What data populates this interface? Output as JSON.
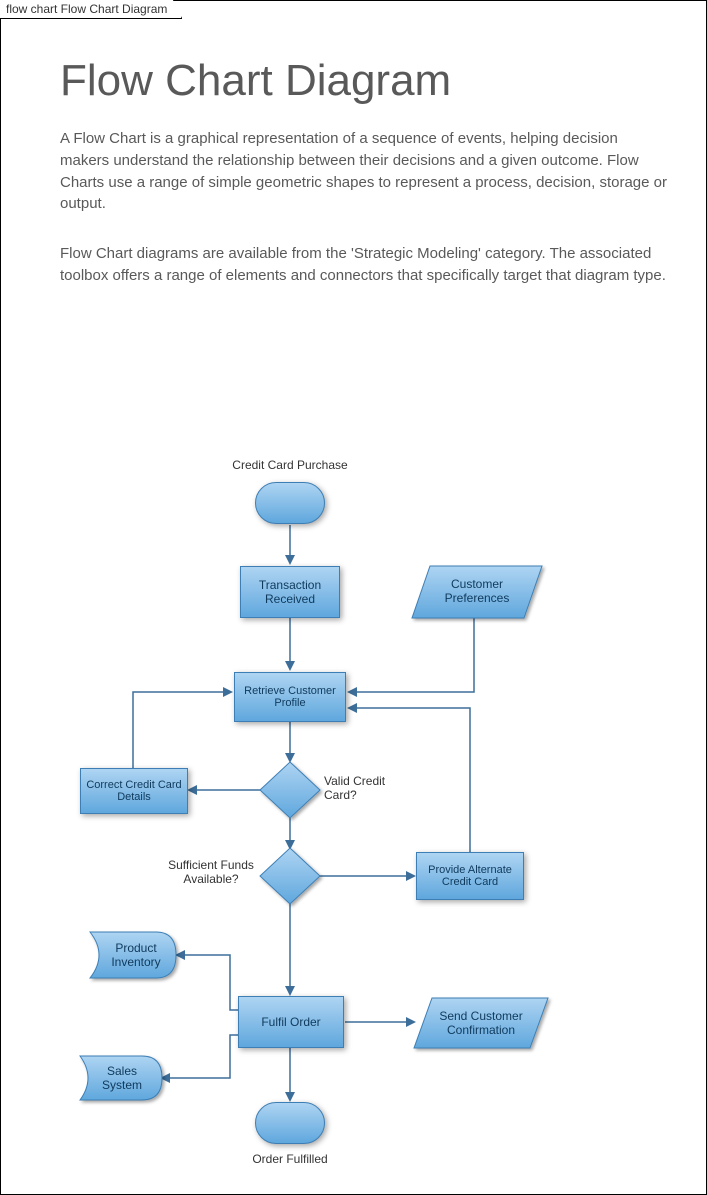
{
  "tab_label": "flow chart Flow Chart Diagram",
  "title": "Flow Chart Diagram",
  "para1": "A Flow Chart is a graphical representation of a sequence of events, helping decision makers understand the relationship between their decisions and a given outcome.  Flow Charts use a range of simple geometric shapes to represent a process, decision, storage or output.",
  "para2": "Flow Chart diagrams are available from the 'Strategic Modeling' category.  The associated toolbox offers a range of elements and connectors that specifically target that diagram type.",
  "labels": {
    "start": "Credit Card Purchase",
    "end": "Order Fulfilled",
    "valid_card": "Valid Credit Card?",
    "sufficient_funds": "Sufficient Funds Available?"
  },
  "nodes": {
    "transaction_received": "Transaction Received",
    "customer_preferences": "Customer Preferences",
    "retrieve_profile": "Retrieve Customer Profile",
    "correct_details": "Correct Credit Card Details",
    "provide_alternate": "Provide Alternate Credit Card",
    "product_inventory": "Product Inventory",
    "fulfil_order": "Fulfil Order",
    "send_confirmation": "Send Customer Confirmation",
    "sales_system": "Sales System"
  }
}
